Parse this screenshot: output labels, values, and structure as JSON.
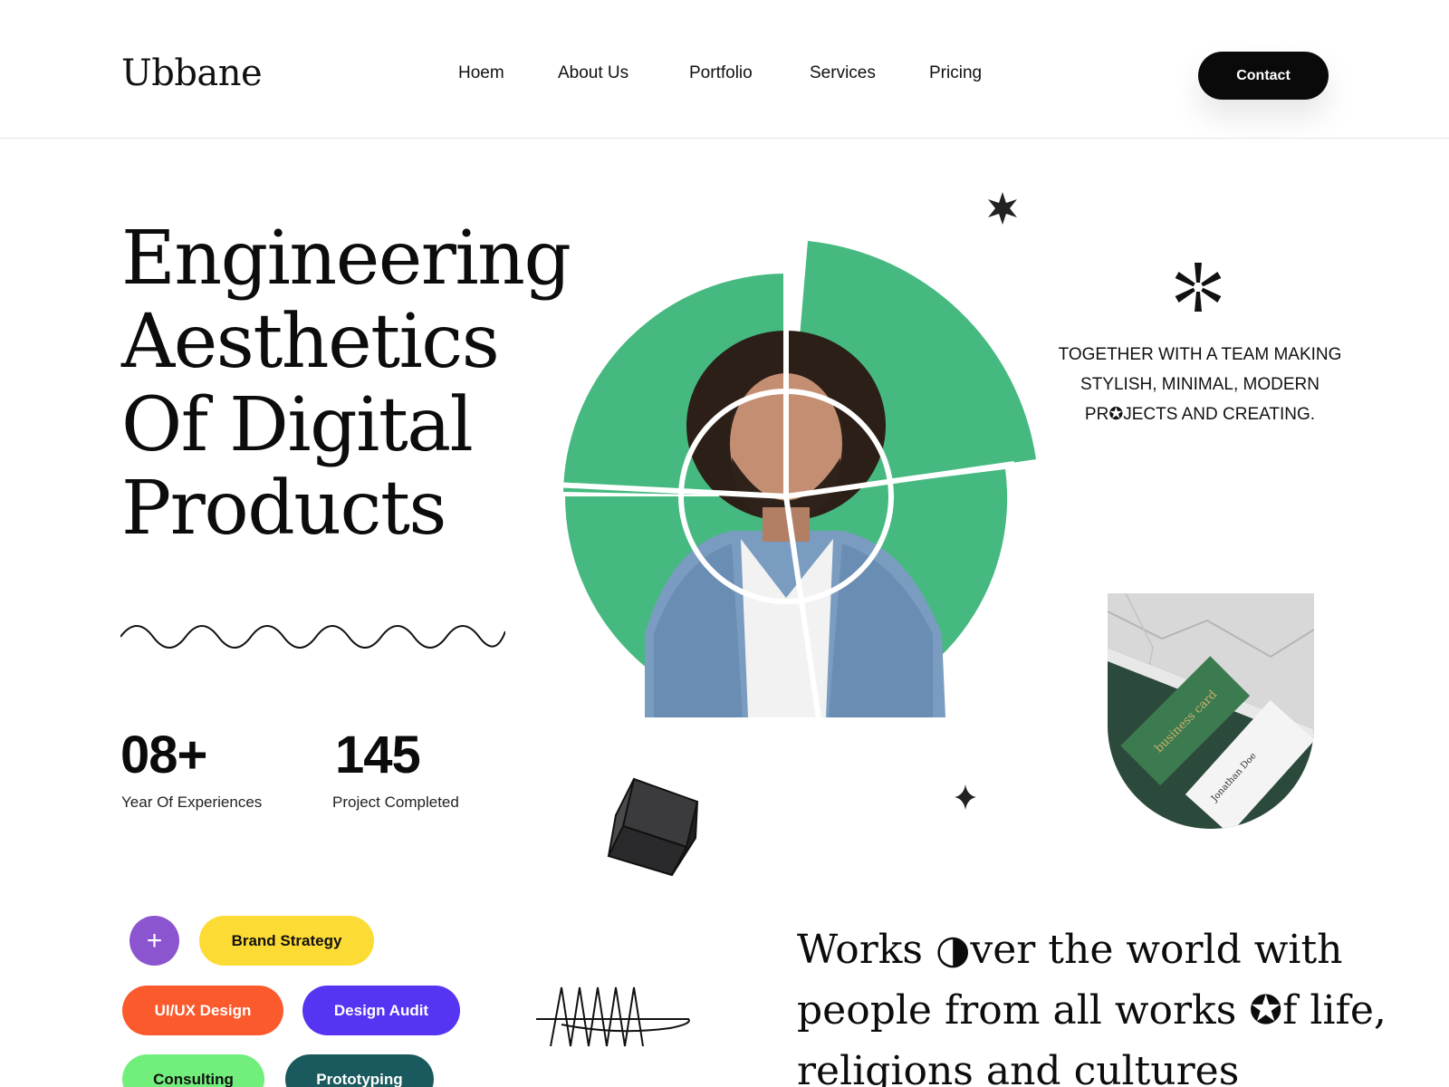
{
  "header": {
    "logo": "Ubbane",
    "nav": [
      "Hoem",
      "About Us",
      "Portfolio",
      "Services",
      "Pricing"
    ],
    "contact_label": "Contact"
  },
  "hero": {
    "headline_lines": [
      "Engineering",
      "Aesthetics",
      "Of Digital",
      "Products"
    ],
    "stats": [
      {
        "value": "08+",
        "label": "Year Of Experiences"
      },
      {
        "value": "145",
        "label": "Project Completed"
      }
    ],
    "tagline_lines": [
      "TOGETHER WITH A TEAM MAKING",
      "STYLISH, MINIMAL, MODERN",
      "PR✪JECTS AND CREATING."
    ],
    "card_text": {
      "front": "business card",
      "back": "Jonathan Doe"
    }
  },
  "tags": {
    "plus": "+",
    "items": [
      {
        "label": "Brand Strategy",
        "color": "#fddb35",
        "text_color": "#111111"
      },
      {
        "label": "UI/UX Design",
        "color": "#fa5a2c",
        "text_color": "#ffffff"
      },
      {
        "label": "Design Audit",
        "color": "#5634f2",
        "text_color": "#ffffff"
      },
      {
        "label": "Consulting",
        "color": "#72ee7c",
        "text_color": "#111111"
      },
      {
        "label": "Prototyping",
        "color": "#1a5a5e",
        "text_color": "#ffffff"
      }
    ]
  },
  "works": {
    "lines": [
      "Works ◑ver the world with",
      "people from all works ✪f life,",
      "religions and cultures"
    ]
  },
  "colors": {
    "accent_green": "#46b980",
    "dark": "#0a0a0a"
  }
}
